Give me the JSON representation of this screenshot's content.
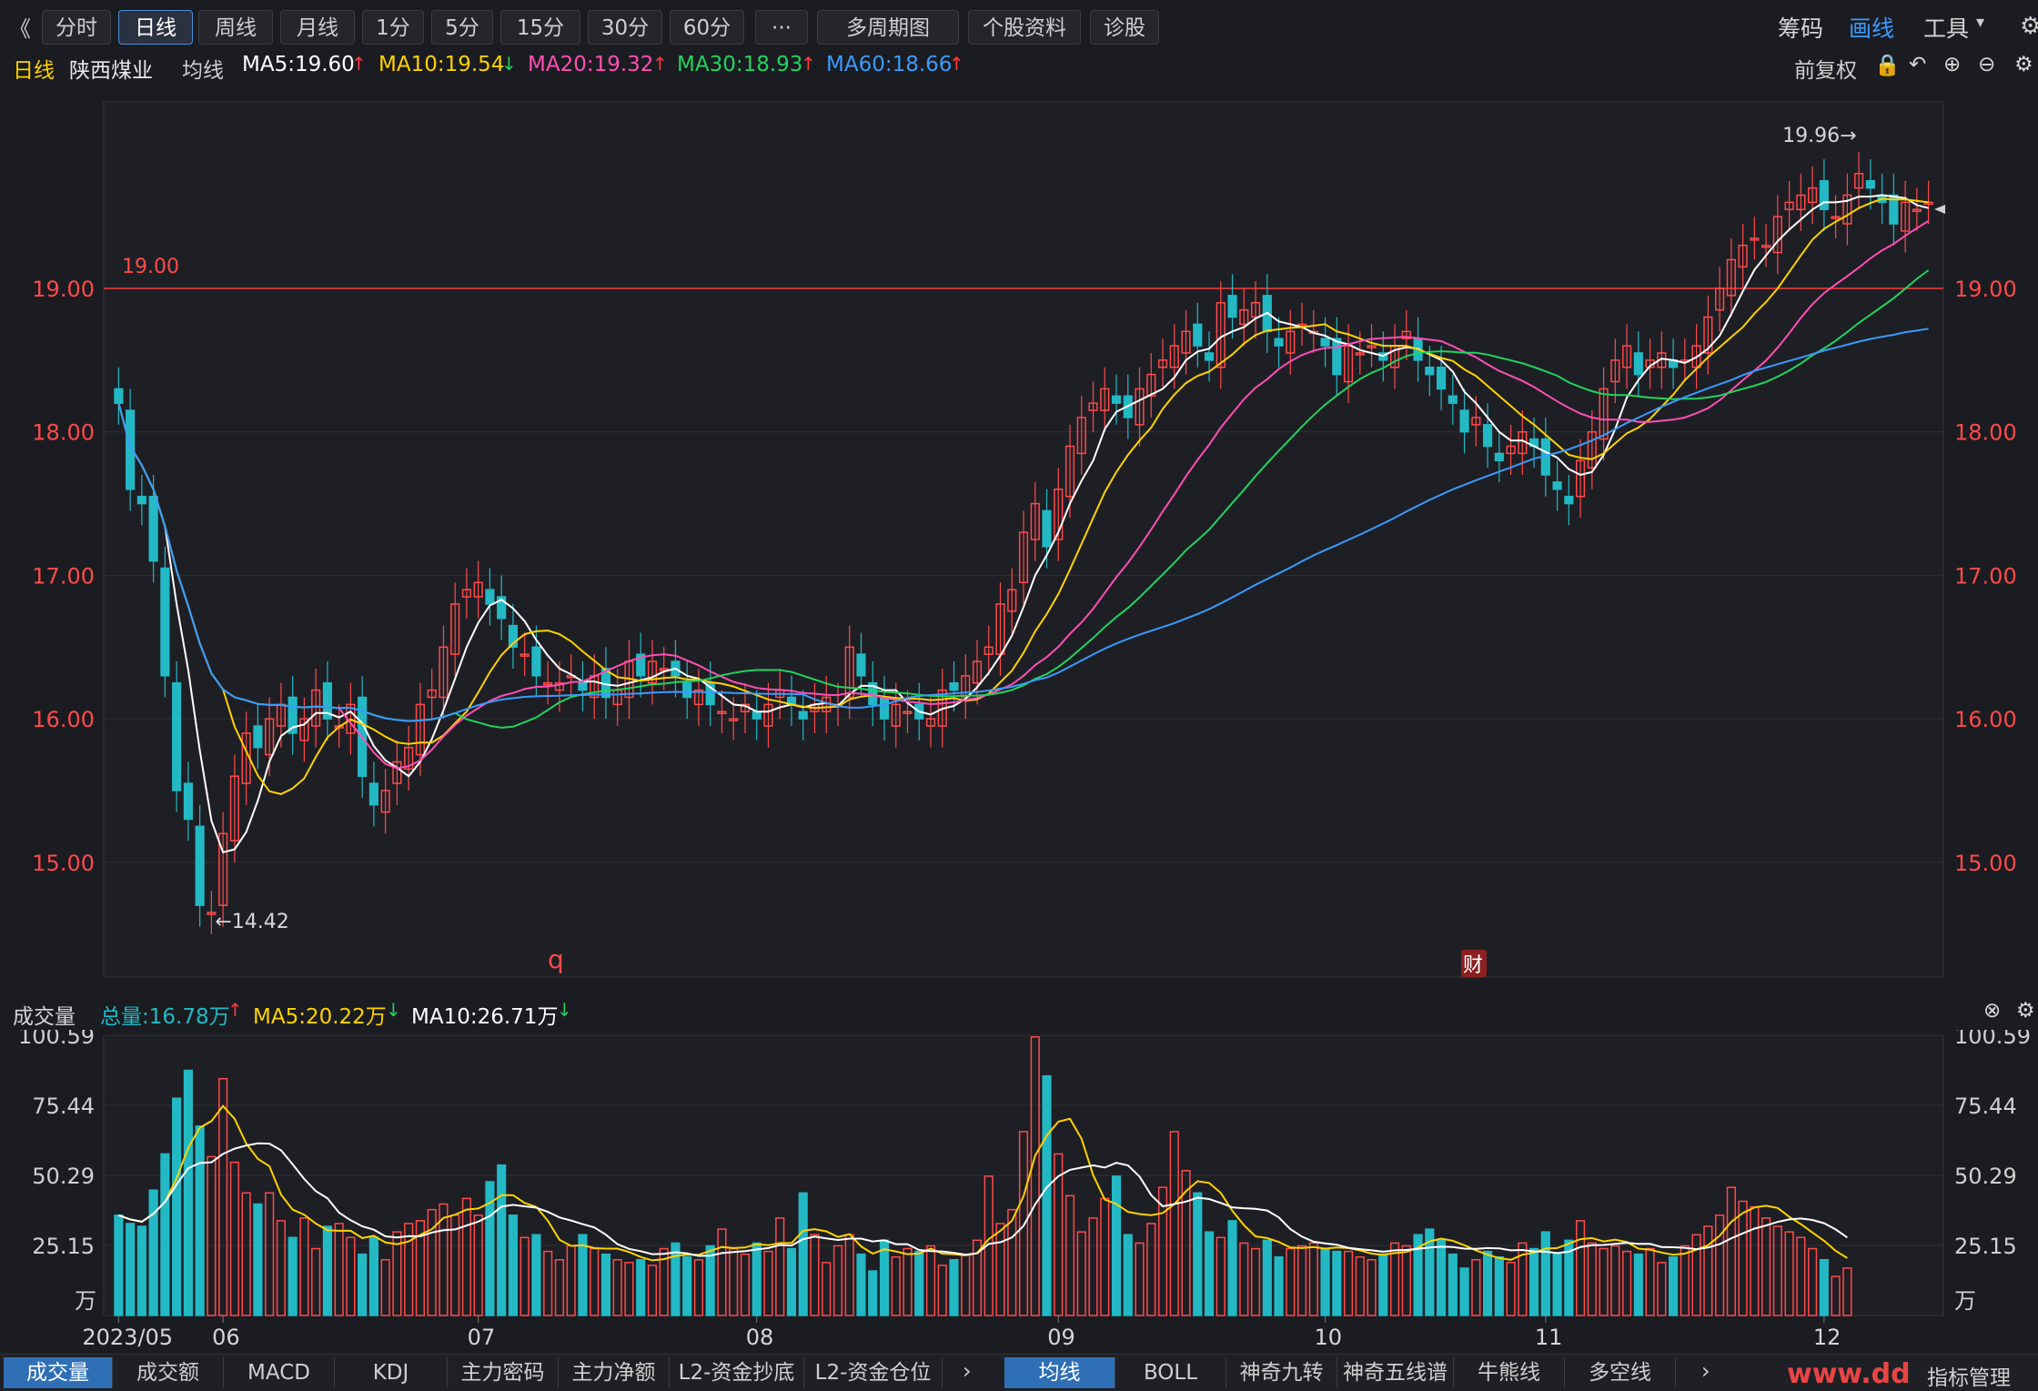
{
  "toolbar": {
    "back_icon": "《",
    "buttons": [
      "分时",
      "日线",
      "周线",
      "月线",
      "1分",
      "5分",
      "15分",
      "30分",
      "60分",
      "···",
      "多周期图",
      "个股资料",
      "诊股"
    ],
    "multi_dropdown_icon": "chevron-down-icon",
    "right": {
      "chips": "筹码",
      "draw": "画线",
      "tools": "工具"
    }
  },
  "info": {
    "period": "日线",
    "stock_name": "陕西煤业",
    "ma_label": "均线",
    "ma5": "MA5:19.60",
    "ma10": "MA10:19.54",
    "ma20": "MA20:19.32",
    "ma30": "MA30:18.93",
    "ma60": "MA60:18.66",
    "fq": "前复权"
  },
  "volume_header": {
    "title": "成交量",
    "total": "总量:16.78万",
    "ma5": "MA5:20.22万",
    "ma10": "MA10:26.71万"
  },
  "bottom_tabs_left": [
    "成交量",
    "成交额",
    "MACD",
    "KDJ",
    "主力密码",
    "主力净额",
    "L2-资金抄底",
    "L2-资金仓位"
  ],
  "bottom_tabs_right": [
    "均线",
    "BOLL",
    "神奇九转",
    "神奇五线谱",
    "牛熊线",
    "多空线"
  ],
  "bottom_right_label": "指标管理",
  "watermark": "www.dd",
  "colors": {
    "up": "#ff4a4a",
    "down": "#22b9c5",
    "ma5": "#ffffff",
    "ma10": "#ffd200",
    "ma20": "#ff4fb4",
    "ma30": "#22d35e",
    "ma60": "#3a9bff",
    "accent": "#4a8fd6"
  },
  "chart_data": {
    "type": "candlestick",
    "symbol": "陕西煤业",
    "period": "日线",
    "price_ticks": [
      15.0,
      16.0,
      17.0,
      18.0,
      19.0
    ],
    "ylim_price": [
      14.2,
      20.3
    ],
    "horizontal_line": {
      "label": "19.00",
      "value": 19.0
    },
    "annotations": {
      "high": "19.96→",
      "low": "←14.42"
    },
    "markers": {
      "q": "q",
      "fin": "财"
    },
    "volume_ticks": [
      "100.59",
      "75.44",
      "50.29",
      "25.15"
    ],
    "volume_unit": "万",
    "ylim_volume": [
      0,
      100.59
    ],
    "month_labels": [
      "2023/05",
      "06",
      "07",
      "08",
      "09",
      "10",
      "11",
      "12"
    ],
    "month_label_index": [
      0,
      9,
      31,
      55,
      81,
      104,
      123,
      147
    ],
    "close": [
      18.2,
      17.6,
      17.5,
      17.1,
      16.3,
      15.5,
      15.3,
      14.7,
      14.65,
      15.2,
      15.6,
      15.9,
      15.8,
      16.0,
      16.1,
      15.9,
      16.0,
      16.2,
      16.0,
      15.95,
      16.1,
      15.6,
      15.4,
      15.5,
      15.7,
      15.8,
      16.1,
      16.2,
      16.5,
      16.8,
      16.9,
      16.95,
      16.8,
      16.7,
      16.5,
      16.45,
      16.3,
      16.25,
      16.25,
      16.3,
      16.2,
      16.3,
      16.15,
      16.2,
      16.4,
      16.3,
      16.4,
      16.35,
      16.3,
      16.15,
      16.2,
      16.1,
      16.05,
      16.0,
      16.1,
      16.0,
      16.1,
      16.2,
      16.1,
      16.0,
      16.1,
      16.15,
      16.1,
      16.5,
      16.3,
      16.1,
      16.0,
      16.1,
      16.05,
      16.0,
      16.0,
      16.2,
      16.2,
      16.3,
      16.4,
      16.5,
      16.8,
      16.9,
      17.3,
      17.5,
      17.2,
      17.6,
      17.9,
      18.1,
      18.2,
      18.3,
      18.2,
      18.1,
      18.3,
      18.4,
      18.5,
      18.6,
      18.7,
      18.6,
      18.5,
      18.9,
      18.8,
      18.85,
      18.9,
      18.7,
      18.6,
      18.7,
      18.75,
      18.7,
      18.6,
      18.4,
      18.6,
      18.55,
      18.6,
      18.5,
      18.6,
      18.7,
      18.5,
      18.4,
      18.3,
      18.2,
      18.0,
      18.1,
      17.9,
      17.8,
      17.9,
      18.0,
      17.9,
      17.7,
      17.6,
      17.5,
      17.8,
      18.0,
      18.3,
      18.5,
      18.6,
      18.4,
      18.5,
      18.55,
      18.45,
      18.5,
      18.6,
      18.8,
      19.0,
      19.2,
      19.3,
      19.35,
      19.3,
      19.5,
      19.6,
      19.65,
      19.7,
      19.55,
      19.5,
      19.65,
      19.8,
      19.7,
      19.6,
      19.45,
      19.6,
      19.55,
      19.6
    ],
    "volume": [
      36,
      33,
      32,
      45,
      58,
      78,
      88,
      68,
      57,
      85,
      55,
      44,
      40,
      44,
      34,
      28,
      35,
      24,
      32,
      33,
      28,
      22,
      28,
      20,
      30,
      33,
      34,
      38,
      40,
      36,
      42,
      36,
      48,
      54,
      36,
      28,
      29,
      23,
      20,
      25,
      29,
      24,
      22,
      20,
      19,
      20,
      18,
      24,
      26,
      21,
      20,
      25,
      31,
      24,
      22,
      26,
      23,
      35,
      24,
      44,
      29,
      19,
      25,
      29,
      22,
      16,
      27,
      21,
      24,
      23,
      25,
      18,
      20,
      22,
      27,
      50,
      33,
      38,
      66,
      100,
      86,
      58,
      43,
      30,
      35,
      42,
      50,
      29,
      26,
      33,
      46,
      66,
      52,
      44,
      30,
      28,
      34,
      26,
      24,
      27,
      21,
      24,
      25,
      26,
      24,
      23,
      23,
      21,
      20,
      22,
      26,
      25,
      29,
      31,
      27,
      22,
      17,
      20,
      23,
      21,
      19,
      26,
      24,
      30,
      22,
      27,
      34,
      26,
      24,
      25,
      23,
      22,
      24,
      19,
      21,
      25,
      29,
      32,
      36,
      46,
      41,
      39,
      35,
      32,
      30,
      28,
      24,
      20,
      14,
      17
    ]
  }
}
